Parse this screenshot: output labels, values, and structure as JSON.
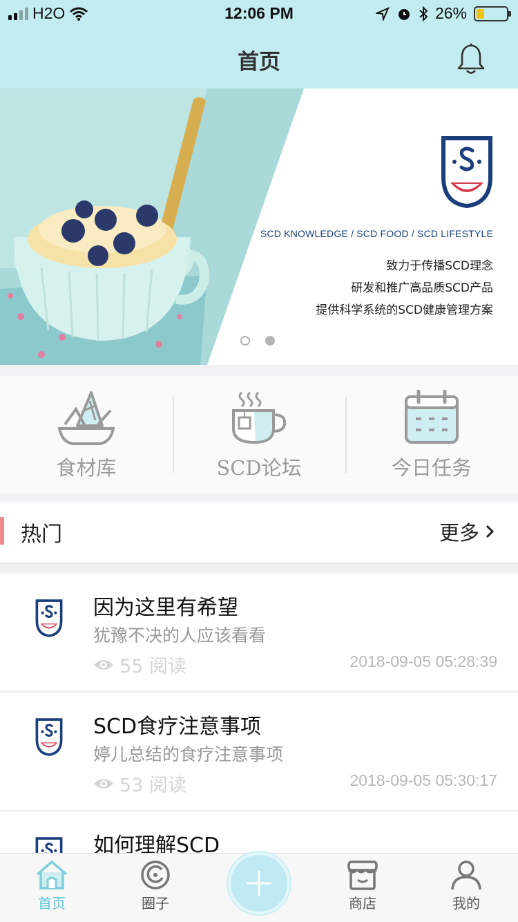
{
  "status_bar": {
    "carrier": "H2O",
    "time": "12:06 PM",
    "battery": "26%",
    "battery_level": 0.26
  },
  "header": {
    "title": "首页"
  },
  "banner": {
    "tagline": "SCD KNOWLEDGE / SCD FOOD / SCD LIFESTYLE",
    "lines": [
      "致力于传播SCD理念",
      "研发和推广高品质SCD产品",
      "提供科学系统的SCD健康管理方案"
    ],
    "page_count": 2,
    "active_page": 2
  },
  "quick_menu": [
    {
      "label": "食材库",
      "icon": "food-bowl-icon"
    },
    {
      "label": "SCD论坛",
      "icon": "tea-cup-icon"
    },
    {
      "label": "今日任务",
      "icon": "calendar-icon"
    }
  ],
  "hot": {
    "title": "热门",
    "more": "更多"
  },
  "articles": [
    {
      "title": "因为这里有希望",
      "subtitle": "犹豫不决的人应该看看",
      "views": "55 阅读",
      "time": "2018-09-05 05:28:39"
    },
    {
      "title": "SCD食疗注意事项",
      "subtitle": "婷儿总结的食疗注意事项",
      "views": "53 阅读",
      "time": "2018-09-05 05:30:17"
    },
    {
      "title": "如何理解SCD",
      "subtitle": "",
      "views": "",
      "time": ""
    }
  ],
  "tabs": [
    {
      "label": "首页",
      "icon": "home-icon",
      "active": true
    },
    {
      "label": "圈子",
      "icon": "circle-icon",
      "active": false
    },
    {
      "label": "",
      "icon": "plus-icon",
      "active": false
    },
    {
      "label": "商店",
      "icon": "shop-icon",
      "active": false
    },
    {
      "label": "我的",
      "icon": "profile-icon",
      "active": false
    }
  ],
  "colors": {
    "header_bg": "#c3ecf0",
    "accent": "#5cc4d6",
    "hot_mark": "#f08a8c",
    "brand_navy": "#1a3d7c",
    "brand_red": "#d8394b"
  }
}
